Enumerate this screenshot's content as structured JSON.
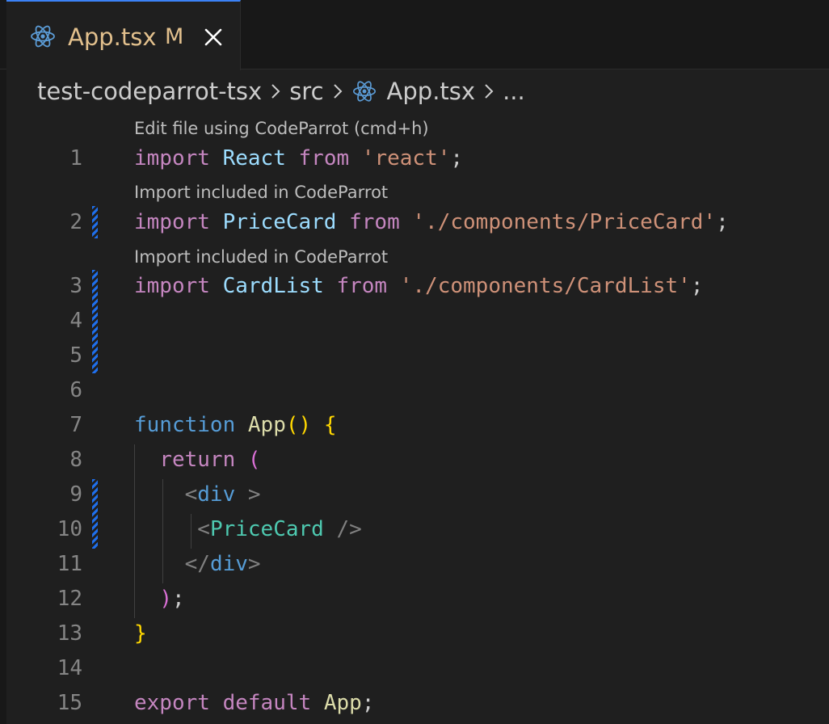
{
  "tab": {
    "filename": "App.tsx",
    "modified_badge": "M",
    "icon": "react-icon",
    "close_icon": "close-icon"
  },
  "breadcrumb": {
    "items": [
      "test-codeparrot-tsx",
      "src",
      "App.tsx",
      "..."
    ]
  },
  "codelens": {
    "edit": "Edit file using CodeParrot (cmd+h)",
    "import1": "Import included in CodeParrot",
    "import2": "Import included in CodeParrot"
  },
  "editor": {
    "line_numbers": [
      "1",
      "2",
      "3",
      "4",
      "5",
      "6",
      "7",
      "8",
      "9",
      "10",
      "11",
      "12",
      "13",
      "14",
      "15"
    ],
    "lines": {
      "l1": {
        "kw": "import",
        "id": "React",
        "from": "from",
        "str": "'react'",
        "semi": ";"
      },
      "l2": {
        "kw": "import",
        "id": "PriceCard",
        "from": "from",
        "str": "'./components/PriceCard'",
        "semi": ";"
      },
      "l3": {
        "kw": "import",
        "id": "CardList",
        "from": "from",
        "str": "'./components/CardList'",
        "semi": ";"
      },
      "l7": {
        "kw": "function",
        "name": "App",
        "parens": "()",
        "brace": "{"
      },
      "l8": {
        "kw": "return",
        "paren": "("
      },
      "l9": {
        "open": "<",
        "tag": "div",
        "close": " >"
      },
      "l10": {
        "open": "<",
        "comp": "PriceCard",
        "close": " />"
      },
      "l11": {
        "open": "</",
        "tag": "div",
        "close": ">"
      },
      "l12": {
        "paren": ")",
        "semi": ";"
      },
      "l13": {
        "brace": "}"
      },
      "l15": {
        "kw1": "export",
        "kw2": "default",
        "id": "App",
        "semi": ";"
      }
    }
  },
  "colors": {
    "accent": "#3b82f6",
    "modified": "#e2c08d",
    "gutter_change": "#1f6feb"
  }
}
